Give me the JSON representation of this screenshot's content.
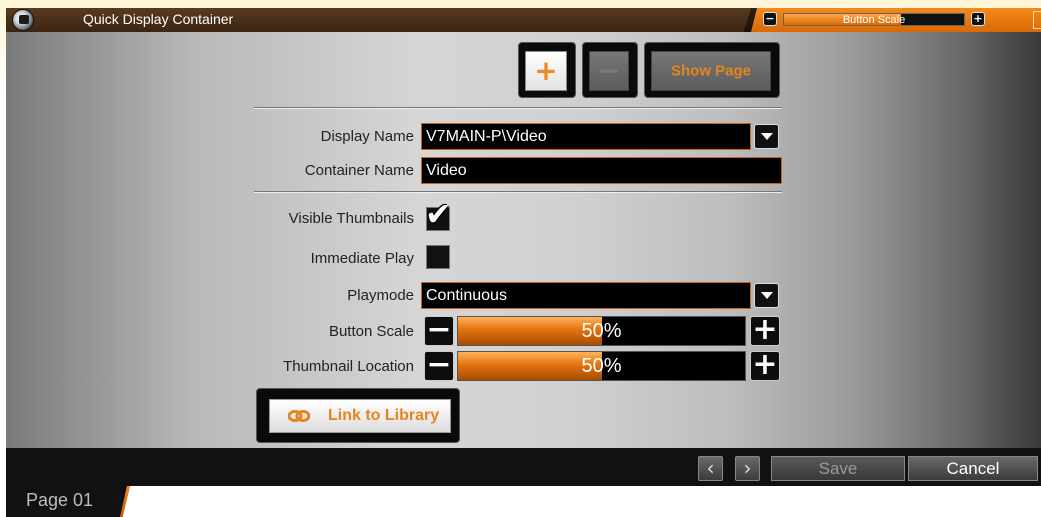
{
  "window": {
    "title": "Quick Display Container",
    "button_scale": {
      "label": "Button Scale",
      "minus": "−",
      "plus": "+",
      "value": 0.65
    }
  },
  "toolbar": {
    "add_glyph": "+",
    "remove_glyph": "−",
    "show_page_label": "Show Page"
  },
  "form": {
    "display_name": {
      "label": "Display Name",
      "value": "V7MAIN-P\\Video"
    },
    "container_name": {
      "label": "Container Name",
      "value": "Video"
    },
    "visible_thumbnails": {
      "label": "Visible Thumbnails",
      "checked": true,
      "mark": "✔"
    },
    "immediate_play": {
      "label": "Immediate Play",
      "checked": false
    },
    "playmode": {
      "label": "Playmode",
      "value": "Continuous"
    },
    "button_scale": {
      "label": "Button Scale",
      "value_text": "50%",
      "value": 0.5
    },
    "thumbnail_location": {
      "label": "Thumbnail Location",
      "value_text": "50%",
      "value": 0.5
    },
    "minus": "−",
    "plus": "+"
  },
  "link_to_library": {
    "label": "Link to Library"
  },
  "footer": {
    "prev": "‹",
    "next": "›",
    "save_label": "Save",
    "cancel_label": "Cancel"
  },
  "page_tab": {
    "label": "Page 01"
  },
  "colors": {
    "accent": "#e58520",
    "field_border": "#c8641a"
  }
}
